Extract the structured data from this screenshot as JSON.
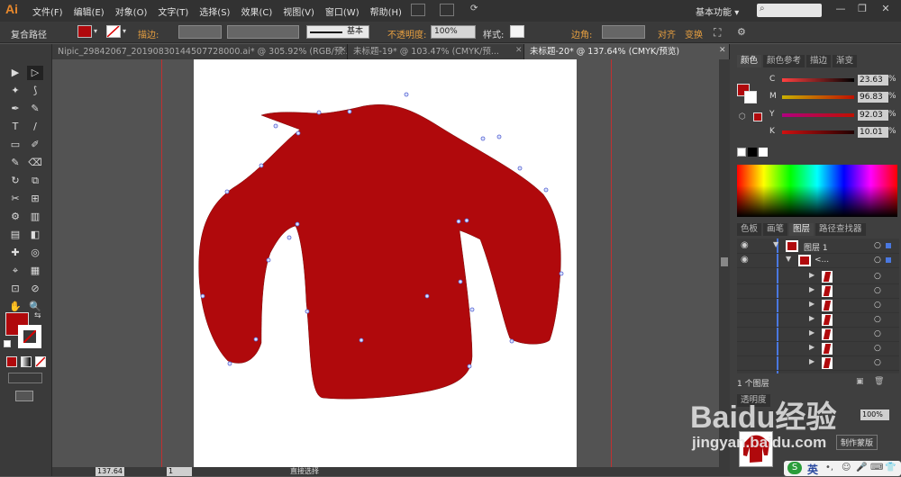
{
  "app": {
    "logo": "Ai",
    "workspace": "基本功能",
    "workspace_arrow": "▾"
  },
  "menu": [
    "文件(F)",
    "编辑(E)",
    "对象(O)",
    "文字(T)",
    "选择(S)",
    "效果(C)",
    "视图(V)",
    "窗口(W)",
    "帮助(H)"
  ],
  "window_buttons": {
    "minimize": "—",
    "maximize": "❐",
    "close": "✕"
  },
  "control_bar": {
    "selection_type": "复合路径",
    "stroke_label": "描边:",
    "stroke_style": "基本",
    "opacity_label": "不透明度:",
    "opacity_value": "100%",
    "style_label": "样式:",
    "corner_label": "边角:",
    "align_label": "对齐",
    "transform_label": "变换",
    "fill_color": "#b0090c"
  },
  "doc_tabs": [
    {
      "label": "Nipic_29842067_20190830144507728000.ai* @ 305.92% (RGB/预...",
      "close": "✕"
    },
    {
      "label": "未标题-19* @ 103.47% (CMYK/预...",
      "close": "✕"
    },
    {
      "label": "未标题-20* @ 137.64% (CMYK/预览)",
      "close": "✕",
      "active": true
    }
  ],
  "tools": [
    "▶",
    "▷",
    "✦",
    "⟆",
    "✒",
    "✎",
    "T",
    "/",
    "▭",
    "✐",
    "✎",
    "⌫",
    "↻",
    "⧉",
    "✂",
    "⊞",
    "⚙",
    "▥",
    "▤",
    "◧",
    "✚",
    "◎",
    "⌖",
    "▦",
    "⊡",
    "⊘",
    "✋",
    "🔍"
  ],
  "colors": {
    "fill": "#b0090c",
    "stroke": "#ffffff",
    "sweater": "#b0090c"
  },
  "status": {
    "zoom": "137.64",
    "page": "1",
    "tool": "直接选择"
  },
  "color_panel": {
    "tabs": [
      "颜色",
      "颜色参考",
      "描边",
      "渐变"
    ],
    "channels": [
      {
        "name": "C",
        "value": "23.63",
        "pct": "%"
      },
      {
        "name": "M",
        "value": "96.83",
        "pct": "%"
      },
      {
        "name": "Y",
        "value": "92.03",
        "pct": "%"
      },
      {
        "name": "K",
        "value": "10.01",
        "pct": "%"
      }
    ]
  },
  "layers_panel": {
    "tabs": [
      "色板",
      "画笔",
      "图层",
      "路径查找器"
    ],
    "layer_name": "图层 1",
    "group_name": "<...",
    "footer": "1 个图层",
    "sublayer_count": 7
  },
  "bottom_panel": {
    "tab": "透明度",
    "value": "100%",
    "button": "制作蒙版"
  },
  "watermark": {
    "brand": "Baidu经验",
    "url": "jingyan.baidu.com",
    "ime": "英"
  }
}
